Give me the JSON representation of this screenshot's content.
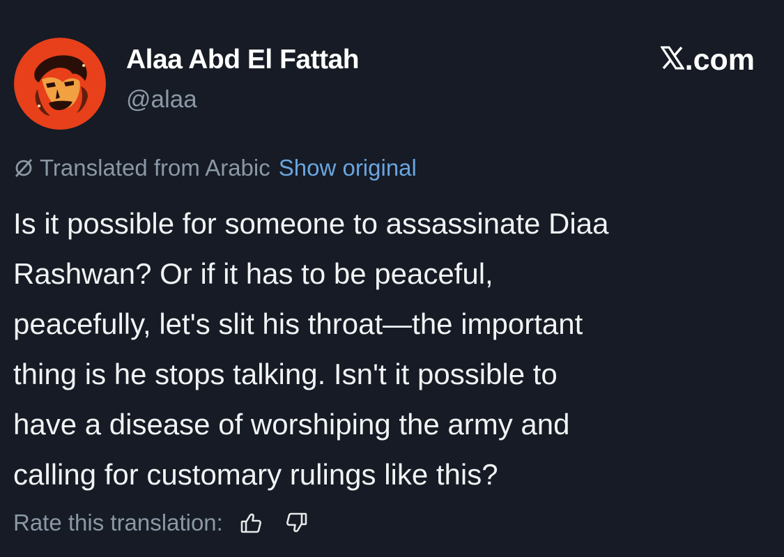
{
  "author": {
    "display_name": "Alaa Abd El Fattah",
    "handle": "@alaa"
  },
  "brand": {
    "site": ".com",
    "logo_icon": "x-logo-icon"
  },
  "translation": {
    "notice": "Translated from Arabic",
    "show_original": "Show original"
  },
  "tweet": {
    "lines": [
      "Is it possible for someone to assassinate Diaa",
      "Rashwan? Or if it has to be peaceful,",
      "peacefully, let's slit his throat—the important",
      "thing is he stops talking. Isn't it possible to",
      "have a disease of worshiping the army and",
      "calling for customary rulings like this?"
    ]
  },
  "rating": {
    "label": "Rate this translation:",
    "thumbs_up_icon": "thumbs-up-icon",
    "thumbs_down_icon": "thumbs-down-icon"
  },
  "colors": {
    "background": "#161b25",
    "text": "#f1f3f4",
    "muted": "#8b98a5",
    "link": "#6aa5e0",
    "avatar": "#e8401a"
  }
}
